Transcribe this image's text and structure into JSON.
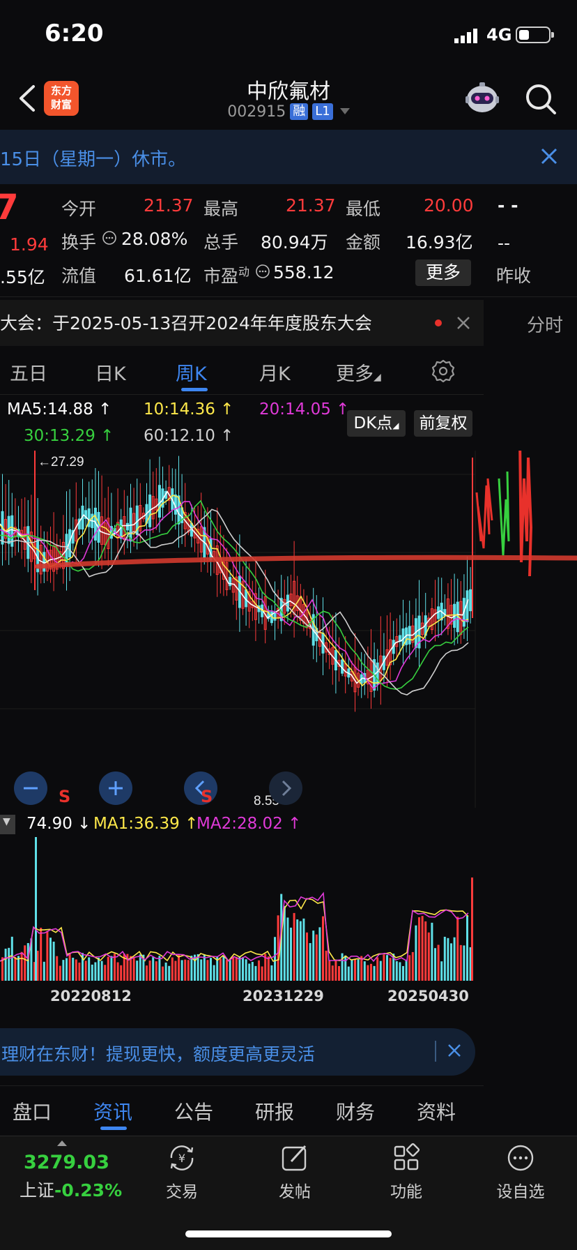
{
  "status_bar": {
    "time": "6:20",
    "network": "4G"
  },
  "header": {
    "logo_line1": "东方",
    "logo_line2": "财富",
    "stock_name": "中欣氟材",
    "stock_code": "002915",
    "tag_margin": "融",
    "tag_level": "L1"
  },
  "notice": {
    "text": "15日（星期一）休市。"
  },
  "quote": {
    "price_partial": "7",
    "change_partial": "1.94",
    "cap_partial": ".55亿",
    "open_label": "今开",
    "open_value": "21.37",
    "high_label": "最高",
    "high_value": "21.37",
    "low_label": "最低",
    "low_value": "20.00",
    "extra_top": "- -",
    "turnover_label": "换手",
    "turnover_value": "28.08%",
    "volume_label": "总手",
    "volume_value": "80.94万",
    "amount_label": "金额",
    "amount_value": "16.93亿",
    "extra_mid": "--",
    "float_label": "流值",
    "float_value": "61.61亿",
    "pe_label": "市盈",
    "pe_sup": "动",
    "pe_value": "558.12",
    "more_label": "更多",
    "prev_close_label": "昨收"
  },
  "meeting": {
    "text": "大会：于2025-05-13召开2024年年度股东大会"
  },
  "right_tab": "分时",
  "period_tabs": [
    {
      "label": "五日"
    },
    {
      "label": "日K"
    },
    {
      "label": "周K"
    },
    {
      "label": "月K"
    },
    {
      "label": "更多"
    }
  ],
  "ma_legend": {
    "ma5": "MA5:14.88 ↑",
    "ma10": "10:14.36 ↑",
    "ma20": "20:14.05 ↑",
    "ma30": "30:13.29 ↑",
    "ma60": "60:12.10 ↑",
    "dk_label": "DK点",
    "fq_label": "前复权"
  },
  "chart_marks": {
    "high_label": "←27.29",
    "low_label": "8.55→",
    "s_mark": "S"
  },
  "volume_legend": {
    "vol": "74.90 ↓",
    "ma1": "MA1:36.39 ↑",
    "ma2": "MA2:28.02 ↑"
  },
  "date_axis": [
    "20220812",
    "20231229",
    "20250430"
  ],
  "promo": {
    "text": "理财在东财！提现更快，额度更高更灵活"
  },
  "info_tabs": [
    {
      "label": "盘口"
    },
    {
      "label": "资讯"
    },
    {
      "label": "公告"
    },
    {
      "label": "研报"
    },
    {
      "label": "财务"
    },
    {
      "label": "资料"
    }
  ],
  "bottom_nav": {
    "index_value": "3279.03",
    "index_name": "上证",
    "index_change": "-0.23%",
    "items": [
      {
        "label": "交易",
        "icon": "trade-icon"
      },
      {
        "label": "发帖",
        "icon": "post-icon"
      },
      {
        "label": "功能",
        "icon": "apps-icon"
      },
      {
        "label": "设自选",
        "icon": "more-icon"
      }
    ]
  },
  "colors": {
    "up": "#ff3b3b",
    "down": "#37d03f",
    "accent": "#3e86f0",
    "ma5": "#ffffff",
    "ma10": "#ffe94a",
    "ma20": "#e03ad8",
    "ma30": "#37d03f",
    "ma60": "#d0d0d0",
    "candle_down": "#5fe0e8"
  }
}
